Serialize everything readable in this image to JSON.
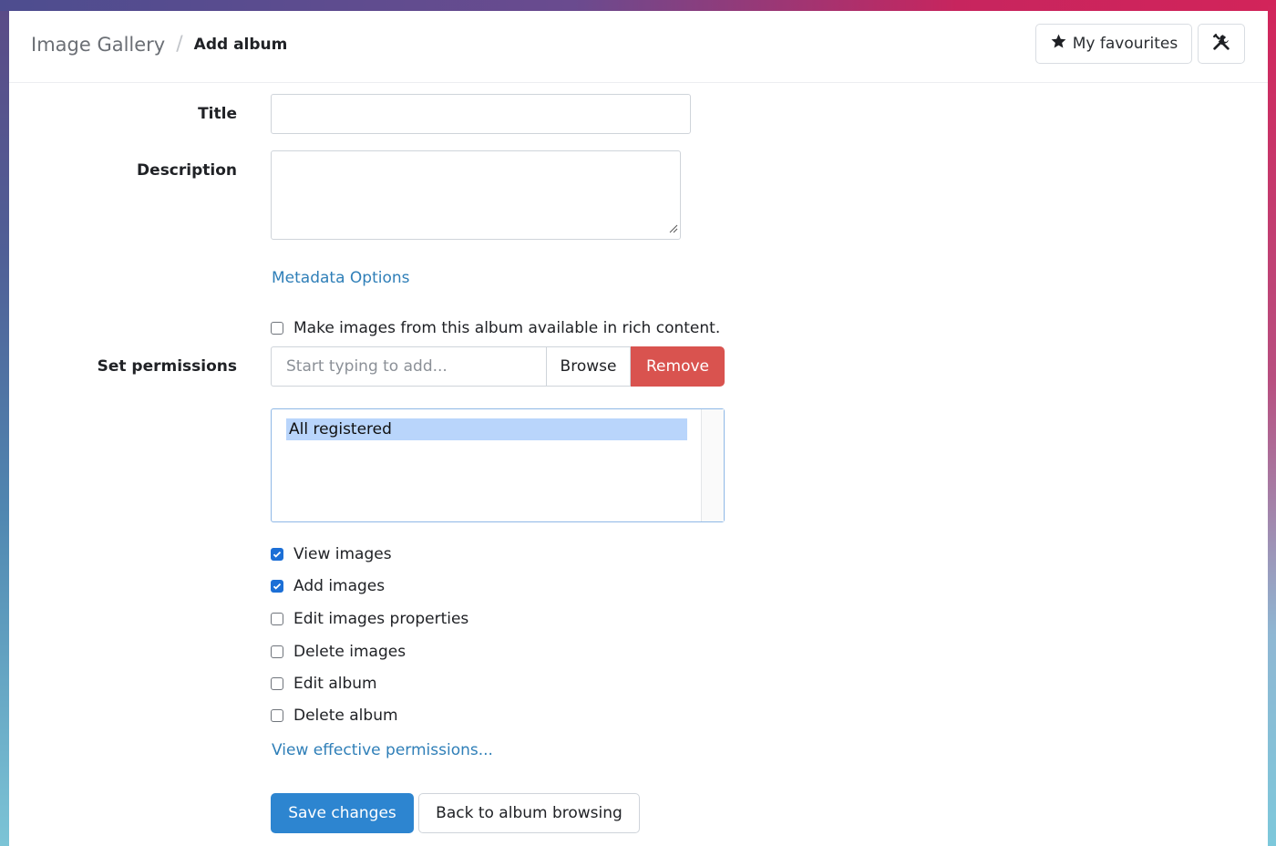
{
  "breadcrumb": {
    "root": "Image Gallery",
    "separator": "/",
    "current": "Add album"
  },
  "header": {
    "favourites_label": "My favourites"
  },
  "form": {
    "title_label": "Title",
    "title_value": "",
    "description_label": "Description",
    "description_value": "",
    "metadata_link": "Metadata Options",
    "rich_content_label": "Make images from this album available in rich content.",
    "permissions_label": "Set permissions",
    "permissions_placeholder": "Start typing to add...",
    "browse_label": "Browse",
    "remove_label": "Remove",
    "permission_groups": [
      "All registered"
    ],
    "permissions": [
      {
        "label": "View images",
        "checked": true
      },
      {
        "label": "Add images",
        "checked": true
      },
      {
        "label": "Edit images properties",
        "checked": false
      },
      {
        "label": "Delete images",
        "checked": false
      },
      {
        "label": "Edit album",
        "checked": false
      },
      {
        "label": "Delete album",
        "checked": false
      }
    ],
    "effective_permissions_link": "View effective permissions...",
    "save_label": "Save changes",
    "back_label": "Back to album browsing"
  },
  "colors": {
    "primary": "#2d85d0",
    "danger": "#d9534f",
    "link": "#2f7fb8",
    "checked": "#1c6fd6"
  }
}
